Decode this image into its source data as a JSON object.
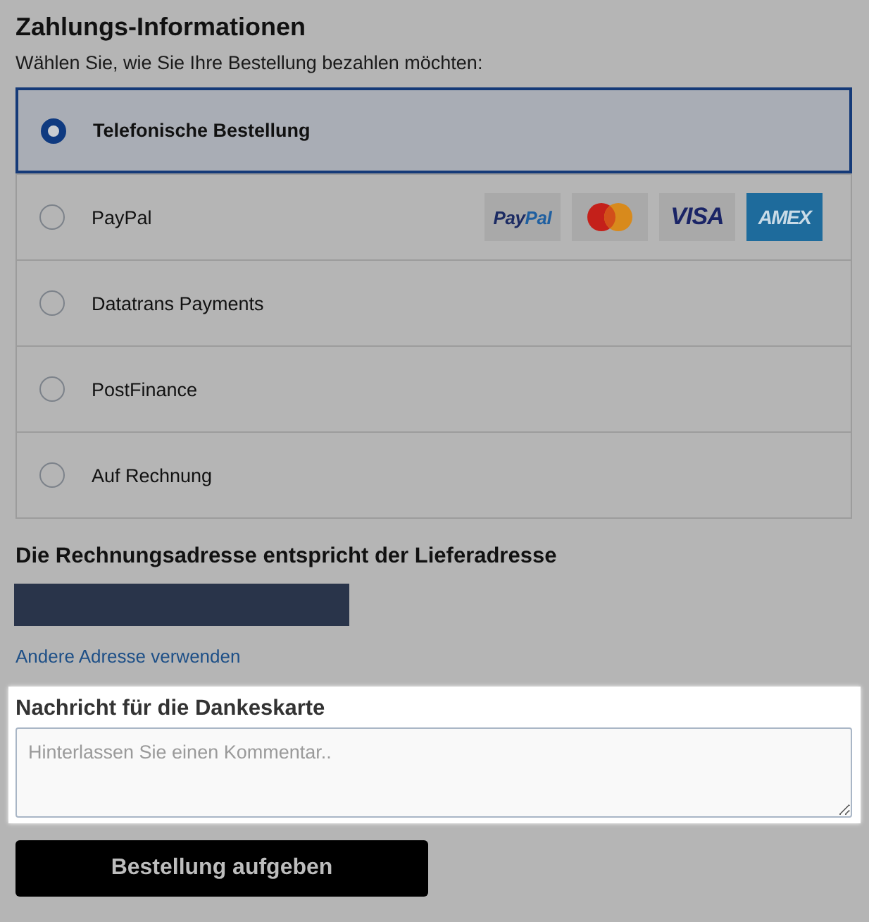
{
  "payment": {
    "title": "Zahlungs-Informationen",
    "subtitle": "Wählen Sie, wie Sie Ihre Bestellung bezahlen möchten:"
  },
  "payment_options": [
    {
      "label": "Telefonische Bestellung",
      "selected": true
    },
    {
      "label": "PayPal",
      "selected": false,
      "logos": [
        {
          "kind": "paypal",
          "parts": [
            "Pay",
            "Pal"
          ]
        },
        {
          "kind": "mastercard"
        },
        {
          "kind": "visa",
          "text": "VISA"
        },
        {
          "kind": "amex",
          "text": "AMEX"
        }
      ]
    },
    {
      "label": "Datatrans Payments",
      "selected": false
    },
    {
      "label": "PostFinance",
      "selected": false
    },
    {
      "label": "Auf Rechnung",
      "selected": false
    }
  ],
  "billing": {
    "title": "Die Rechnungsadresse entspricht der Lieferadresse",
    "link": "Andere Adresse verwenden"
  },
  "message": {
    "label": "Nachricht für die Dankeskarte",
    "placeholder": "Hinterlassen Sie einen Kommentar.."
  },
  "submit_button": "Bestellung aufgeben"
}
